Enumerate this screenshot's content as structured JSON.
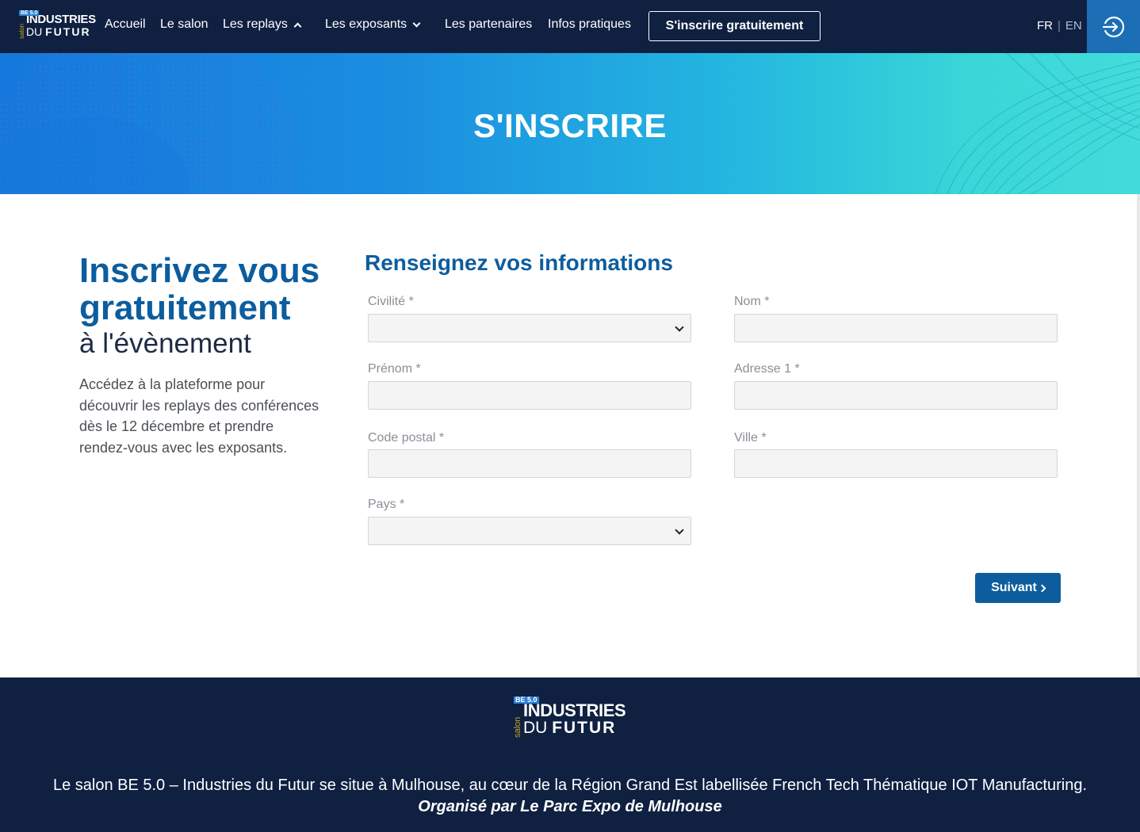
{
  "nav": {
    "logo": {
      "badge": "BE 5.0",
      "salon": "salon",
      "line1": "INDUSTRIES",
      "line2a": "DU",
      "line2b": "FUTUR"
    },
    "items": [
      {
        "label": "Accueil"
      },
      {
        "label": "Le salon"
      },
      {
        "label": "Les replays"
      },
      {
        "label": "Les exposants"
      },
      {
        "label": "Les partenaires"
      },
      {
        "label": "Infos pratiques"
      }
    ],
    "cta": "S'inscrire gratuitement",
    "lang": {
      "fr": "FR",
      "sep": "|",
      "en": "EN"
    },
    "login_icon": "sign-in-icon"
  },
  "hero": {
    "title": "S'INSCRIRE"
  },
  "intro": {
    "title_line1": "Inscrivez vous",
    "title_line2": "gratuitement",
    "subtitle": "à l'évènement",
    "text": "Accédez à la plateforme pour découvrir les replays des conférences dès le 12 décembre et prendre rendez-vous avec les exposants."
  },
  "form": {
    "title": "Renseignez vos informations",
    "fields": {
      "civilite": {
        "label": "Civilité *",
        "value": ""
      },
      "nom": {
        "label": "Nom *",
        "value": ""
      },
      "prenom": {
        "label": "Prénom *",
        "value": ""
      },
      "adresse": {
        "label": "Adresse 1 *",
        "value": ""
      },
      "code_postal": {
        "label": "Code postal *",
        "value": ""
      },
      "ville": {
        "label": "Ville *",
        "value": ""
      },
      "pays": {
        "label": "Pays *",
        "value": ""
      }
    },
    "next_label": "Suivant"
  },
  "footer": {
    "text": "Le salon BE 5.0 – Industries du Futur se situe à Mulhouse, au cœur de la Région Grand Est labellisée French Tech Thématique IOT Manufacturing.",
    "organizer": "Organisé par Le Parc Expo de Mulhouse"
  },
  "colors": {
    "navy": "#0f2041",
    "brand_blue": "#0d5d9e",
    "accent_blue": "#1c6fb5",
    "gold": "#c9a227"
  }
}
